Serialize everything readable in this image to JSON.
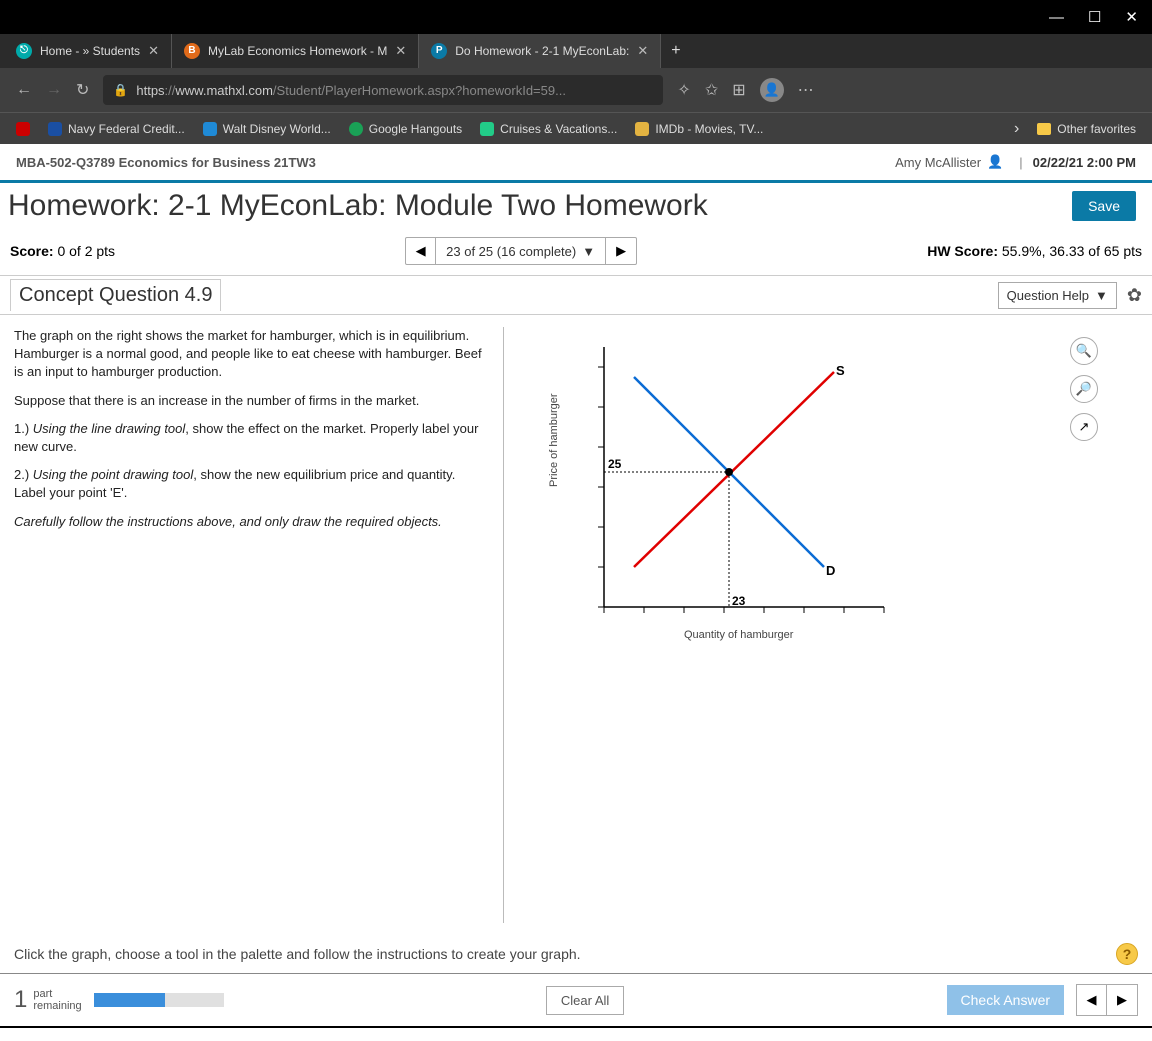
{
  "win": {
    "min": "—",
    "max": "☐",
    "close": "✕"
  },
  "tabs": [
    {
      "title": "Home - » Students",
      "favbg": "#0aa",
      "favtxt": "⎋"
    },
    {
      "title": "MyLab Economics Homework - M",
      "favbg": "#e06a1a",
      "favtxt": "B"
    },
    {
      "title": "Do Homework - 2-1 MyEconLab:",
      "favbg": "#0b7aa6",
      "favtxt": "P"
    }
  ],
  "addr": {
    "scheme": "https",
    "sep": "://",
    "host": "www.mathxl.com",
    "path": "/Student/PlayerHomework.aspx?homeworkId=59..."
  },
  "favs": [
    {
      "label": "Navy Federal Credit...",
      "bg": "#1a4fa3"
    },
    {
      "label": "Walt Disney World...",
      "bg": "#1f8ad6"
    },
    {
      "label": "Google Hangouts",
      "bg": "#1aa156"
    },
    {
      "label": "Cruises & Vacations...",
      "bg": "#2c8"
    },
    {
      "label": "IMDb - Movies, TV...",
      "bg": "#e3b341"
    }
  ],
  "other_fav": "Other favorites",
  "course": {
    "name": "MBA-502-Q3789 Economics for Business 21TW3",
    "user": "Amy McAllister",
    "datetime": "02/22/21 2:00 PM"
  },
  "hw": {
    "title": "Homework: 2-1 MyEconLab: Module Two Homework",
    "save": "Save",
    "score_label": "Score:",
    "score_value": "0 of 2 pts",
    "nav_text": "23 of 25 (16 complete)",
    "hw_score_label": "HW Score:",
    "hw_score_value": "55.9%, 36.33 of 65 pts"
  },
  "q": {
    "title": "Concept Question 4.9",
    "help": "Question Help",
    "p1": "The graph on the right shows the market for hamburger, which is in equilibrium. Hamburger is a normal good, and people like to eat cheese with hamburger. Beef is an input to hamburger production.",
    "p2": "Suppose that there is an increase in the number of firms in the market.",
    "p3a": "1.) ",
    "p3i": "Using the line drawing tool",
    "p3b": ", show the effect on the market. Properly label your new curve.",
    "p4a": "2.) ",
    "p4i": "Using the point drawing tool",
    "p4b": ", show the new equilibrium price and quantity. Label your point 'E'.",
    "p5": "Carefully follow the instructions above, and only draw the required objects."
  },
  "chart_data": {
    "type": "line",
    "title": "",
    "xlabel": "Quantity of hamburger",
    "ylabel": "Price of hamburger",
    "equilibrium": {
      "q": 23,
      "p": 25
    },
    "series": [
      {
        "name": "S",
        "color": "#e00000"
      },
      {
        "name": "D",
        "color": "#0b6bd4"
      }
    ],
    "yvalue_label": "25",
    "xvalue_label": "23"
  },
  "hint": "Click the graph, choose a tool in the palette and follow the instructions to create your graph.",
  "footer": {
    "parts_num": "1",
    "parts_l1": "part",
    "parts_l2": "remaining",
    "clear": "Clear All",
    "check": "Check Answer"
  }
}
